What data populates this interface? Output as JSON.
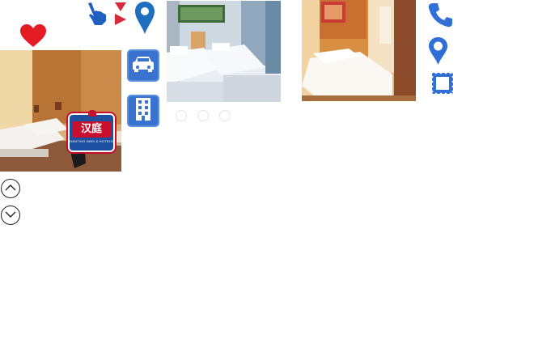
{
  "icons": {
    "heart": "heart-icon",
    "hand": "pointing-hand-icon",
    "triangles": "triangles-icon",
    "location_top": "location-pin-icon",
    "car": "car-icon",
    "building": "building-icon",
    "phone": "phone-icon",
    "location_right": "location-pin-icon",
    "stamp": "stamp-square-icon",
    "scroll_up": "scroll-up-icon",
    "scroll_down": "scroll-down-icon"
  },
  "logo": {
    "name": "汉庭",
    "subtitle": "HANTING INNS & HOTELS"
  },
  "carousel": {
    "dots": 3,
    "active_index": 0
  },
  "colors": {
    "heart": "#e31b23",
    "blue_accent": "#3a73cf",
    "pin_blue": "#1f6fc0",
    "red_triangle": "#d92a3b"
  }
}
